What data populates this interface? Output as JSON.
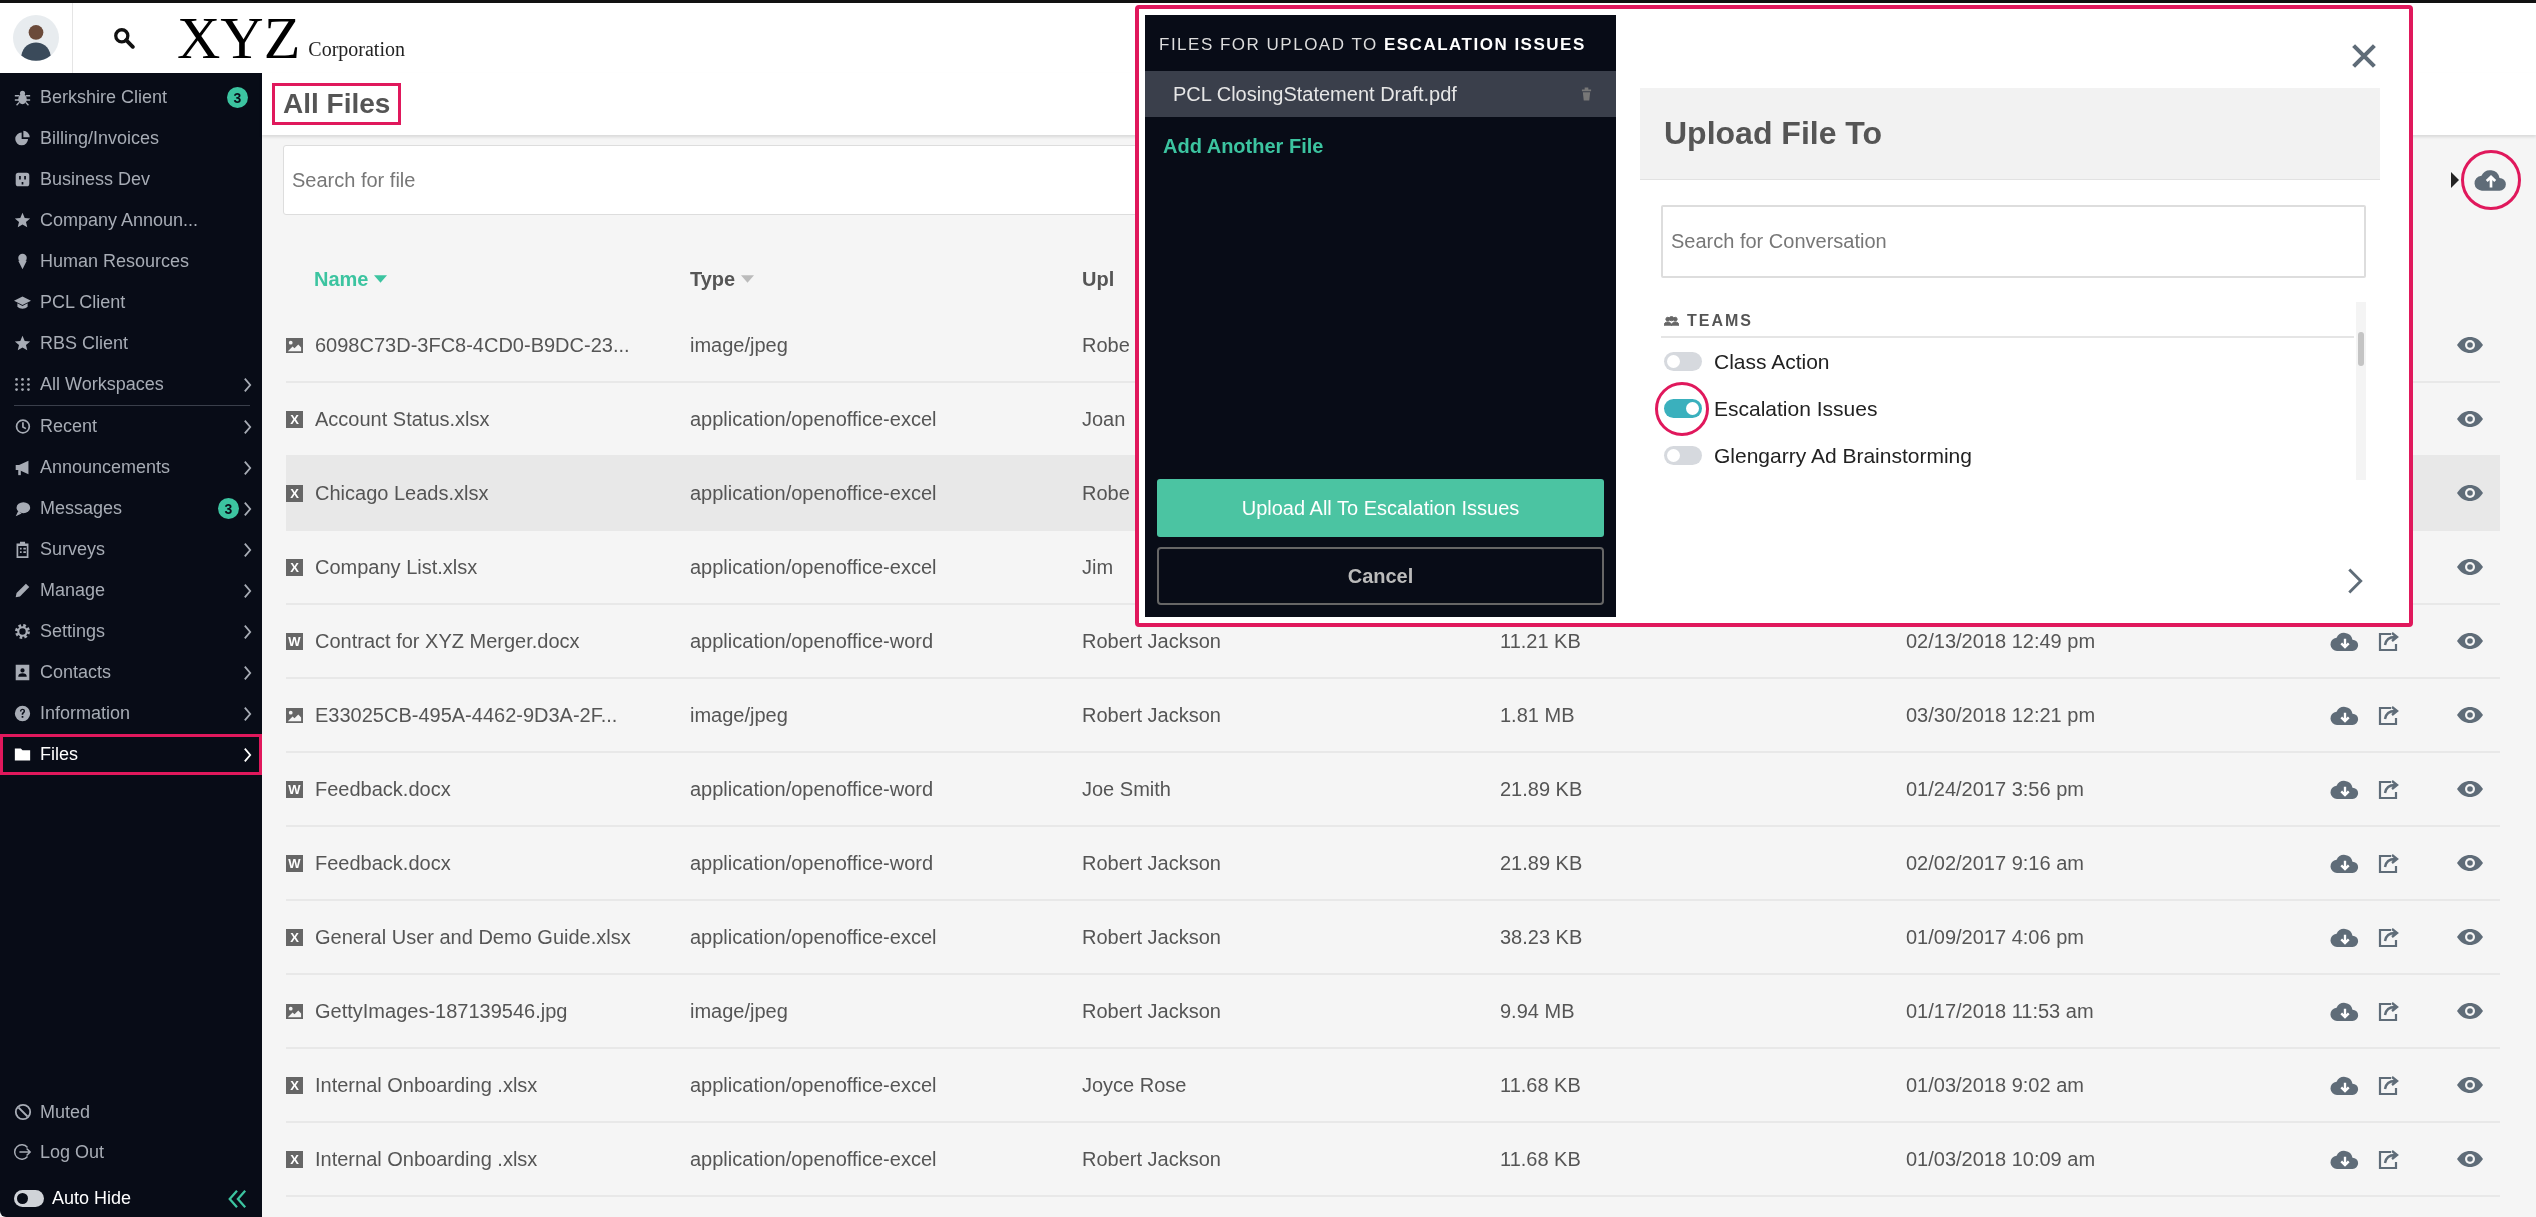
{
  "header": {
    "logo": "XYZ",
    "logo_sub": "Corporation"
  },
  "sidebar": {
    "items": [
      {
        "label": "Berkshire Client",
        "badge": "3",
        "chevron": false,
        "selected": false
      },
      {
        "label": "Billing/Invoices",
        "chevron": false,
        "selected": false
      },
      {
        "label": "Business Dev",
        "chevron": false,
        "selected": false
      },
      {
        "label": "Company Announ...",
        "chevron": false,
        "selected": false
      },
      {
        "label": "Human Resources",
        "chevron": false,
        "selected": false
      },
      {
        "label": "PCL Client",
        "chevron": false,
        "selected": false
      },
      {
        "label": "RBS Client",
        "chevron": false,
        "selected": false
      },
      {
        "label": "All Workspaces",
        "chevron": true,
        "selected": false
      },
      {
        "label": "Recent",
        "chevron": true,
        "selected": false
      },
      {
        "label": "Announcements",
        "chevron": true,
        "selected": false
      },
      {
        "label": "Messages",
        "badge": "3",
        "chevron": true,
        "selected": false
      },
      {
        "label": "Surveys",
        "chevron": true,
        "selected": false
      },
      {
        "label": "Manage",
        "chevron": true,
        "selected": false
      },
      {
        "label": "Settings",
        "chevron": true,
        "selected": false
      },
      {
        "label": "Contacts",
        "chevron": true,
        "selected": false
      },
      {
        "label": "Information",
        "chevron": true,
        "selected": false
      },
      {
        "label": "Files",
        "chevron": true,
        "selected": true
      }
    ],
    "footer": [
      {
        "label": "Muted"
      },
      {
        "label": "Log Out"
      }
    ],
    "auto_hide": {
      "label": "Auto Hide",
      "on": false
    }
  },
  "page_title": "All Files",
  "search": {
    "placeholder": "Search for file"
  },
  "table": {
    "columns": [
      {
        "label": "Name",
        "sorted": true
      },
      {
        "label": "Type",
        "sorted": false
      },
      {
        "label": "Upl"
      }
    ],
    "rows": [
      {
        "kind": "image",
        "name": "6098C73D-3FC8-4CD0-B9DC-23...",
        "type": "image/jpeg",
        "uploader": "Robe",
        "selected": false
      },
      {
        "kind": "sheet",
        "letter": "X",
        "name": "Account Status.xlsx",
        "type": "application/openoffice-excel",
        "uploader": "Joan",
        "selected": false
      },
      {
        "kind": "sheet",
        "letter": "X",
        "name": "Chicago Leads.xlsx",
        "type": "application/openoffice-excel",
        "uploader": "Robe",
        "selected": true
      },
      {
        "kind": "sheet",
        "letter": "X",
        "name": "Company List.xlsx",
        "type": "application/openoffice-excel",
        "uploader": "Jim",
        "selected": false
      },
      {
        "kind": "doc",
        "letter": "W",
        "name": "Contract for XYZ Merger.docx",
        "type": "application/openoffice-word",
        "uploader": "Robert Jackson",
        "size": "11.21 KB",
        "date": "02/13/2018 12:49 pm",
        "selected": false
      },
      {
        "kind": "image",
        "name": "E33025CB-495A-4462-9D3A-2F...",
        "type": "image/jpeg",
        "uploader": "Robert Jackson",
        "size": "1.81 MB",
        "date": "03/30/2018 12:21 pm",
        "selected": false
      },
      {
        "kind": "doc",
        "letter": "W",
        "name": "Feedback.docx",
        "type": "application/openoffice-word",
        "uploader": "Joe Smith",
        "size": "21.89 KB",
        "date": "01/24/2017 3:56 pm",
        "selected": false
      },
      {
        "kind": "doc",
        "letter": "W",
        "name": "Feedback.docx",
        "type": "application/openoffice-word",
        "uploader": "Robert Jackson",
        "size": "21.89 KB",
        "date": "02/02/2017 9:16 am",
        "selected": false
      },
      {
        "kind": "sheet",
        "letter": "X",
        "name": "General User and Demo Guide.xlsx",
        "type": "application/openoffice-excel",
        "uploader": "Robert Jackson",
        "size": "38.23 KB",
        "date": "01/09/2017 4:06 pm",
        "selected": false
      },
      {
        "kind": "image",
        "name": "GettyImages-187139546.jpg",
        "type": "image/jpeg",
        "uploader": "Robert Jackson",
        "size": "9.94 MB",
        "date": "01/17/2018 11:53 am",
        "selected": false
      },
      {
        "kind": "sheet",
        "letter": "X",
        "name": "Internal Onboarding .xlsx",
        "type": "application/openoffice-excel",
        "uploader": "Joyce Rose",
        "size": "11.68 KB",
        "date": "01/03/2018 9:02 am",
        "selected": false
      },
      {
        "kind": "sheet",
        "letter": "X",
        "name": "Internal Onboarding .xlsx",
        "type": "application/openoffice-excel",
        "uploader": "Robert Jackson",
        "size": "11.68 KB",
        "date": "01/03/2018 10:09 am",
        "selected": false
      }
    ]
  },
  "upload_modal": {
    "heading": "FILES FOR UPLOAD TO **ESCALATION ISSUES**",
    "files": [
      {
        "name": "PCL ClosingStatement Draft.pdf"
      }
    ],
    "add_link": "Add Another File",
    "upload_button": "Upload All To Escalation Issues",
    "cancel_button": "Cancel",
    "title": "Upload File To",
    "search": {
      "placeholder": "Search for Conversation"
    },
    "section": "TEAMS",
    "teams": [
      {
        "label": "Class Action",
        "on": false
      },
      {
        "label": "Escalation Issues",
        "on": true
      },
      {
        "label": "Glengarry Ad Brainstorming",
        "on": false
      }
    ]
  }
}
